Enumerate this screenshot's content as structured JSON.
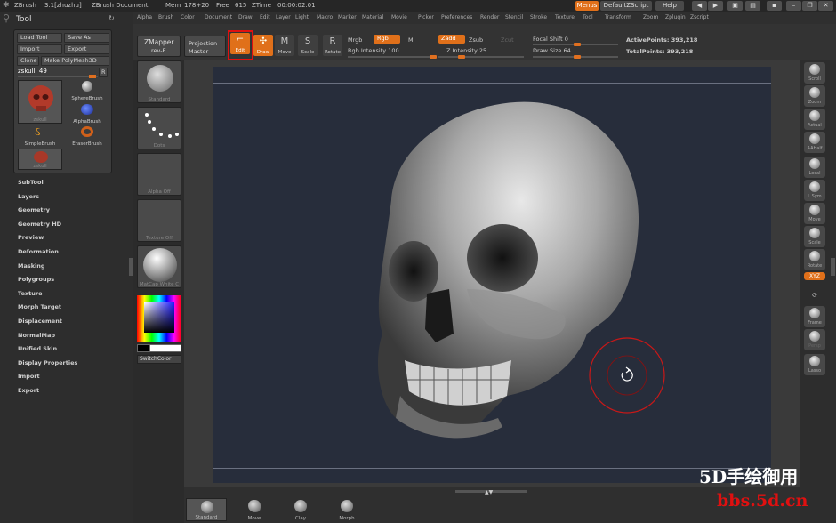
{
  "titlebar": {
    "app": "ZBrush",
    "version": "3.1[zhuzhu]",
    "document": "ZBrush Document",
    "mem": "Mem",
    "mem_value": "178+20",
    "free": "Free",
    "free_value": "615",
    "ztime": "ZTime",
    "ztime_value": "00:00:02.01",
    "menus_btn": "Menus",
    "script_btn": "DefaultZScript",
    "help_btn": "Help"
  },
  "menubar": [
    "Alpha",
    "Brush",
    "Color",
    "Document",
    "Draw",
    "Edit",
    "Layer",
    "Light",
    "Macro",
    "Marker",
    "Material",
    "Movie",
    "Picker",
    "Preferences",
    "Render",
    "Stencil",
    "Stroke",
    "Texture",
    "Tool",
    "Transform",
    "Zoom",
    "Zplugin",
    "Zscript"
  ],
  "tool": {
    "title": "Tool",
    "load": "Load Tool",
    "save": "Save As",
    "import": "Import",
    "export": "Export",
    "clone": "Clone",
    "make_poly": "Make PolyMesh3D",
    "current": "zskull. 49",
    "r_btn": "R",
    "thumbs": [
      "zskull",
      "SphereBrush",
      "AlphaBrush",
      "SimpleBrush",
      "EraserBrush",
      "zskull"
    ]
  },
  "left_menu": [
    "SubTool",
    "Layers",
    "Geometry",
    "Geometry HD",
    "Preview",
    "Deformation",
    "Masking",
    "Polygroups",
    "Texture",
    "Morph Target",
    "Displacement",
    "NormalMap",
    "Unified Skin",
    "Display Properties",
    "Import",
    "Export"
  ],
  "brush_column": {
    "slots": [
      "Standard",
      "Dots",
      "Alpha Off",
      "Texture Off",
      "MatCap White C"
    ],
    "switch_color": "SwitchColor"
  },
  "toolbar": {
    "zmapper": "ZMapper",
    "zmapper_sub": "rev-E",
    "projection": "Projection",
    "projection_sub": "Master",
    "edit": "Edit",
    "draw": "Draw",
    "move": "Move",
    "scale": "Scale",
    "rotate": "Rotate",
    "mrgb": "Mrgb",
    "rgb": "Rgb",
    "m": "M",
    "rgb_intensity": "Rgb Intensity 100",
    "zadd": "Zadd",
    "zsub": "Zsub",
    "zcut": "Zcut",
    "z_intensity": "Z Intensity 25",
    "focal_shift": "Focal Shift 0",
    "draw_size": "Draw Size 64",
    "active_points": "ActivePoints: 393,218",
    "total_points": "TotalPoints: 393,218"
  },
  "right_dock": [
    "Scroll",
    "Zoom",
    "Actual",
    "AAHalf",
    "Local",
    "L.Sym",
    "Move",
    "Scale",
    "Rotate",
    "XYZ",
    "",
    "Frame",
    "Persp",
    "Lasso"
  ],
  "bottom_bar": [
    "Standard",
    "Move",
    "Clay",
    "Morph"
  ],
  "watermark": {
    "line1": "5D手绘御用",
    "line2": "bbs.5d.cn"
  },
  "colors": {
    "accent": "#e0701a",
    "highlight_box": "#e01010",
    "canvas_bg": "#272d3b",
    "brush_ring": "#c81818"
  }
}
